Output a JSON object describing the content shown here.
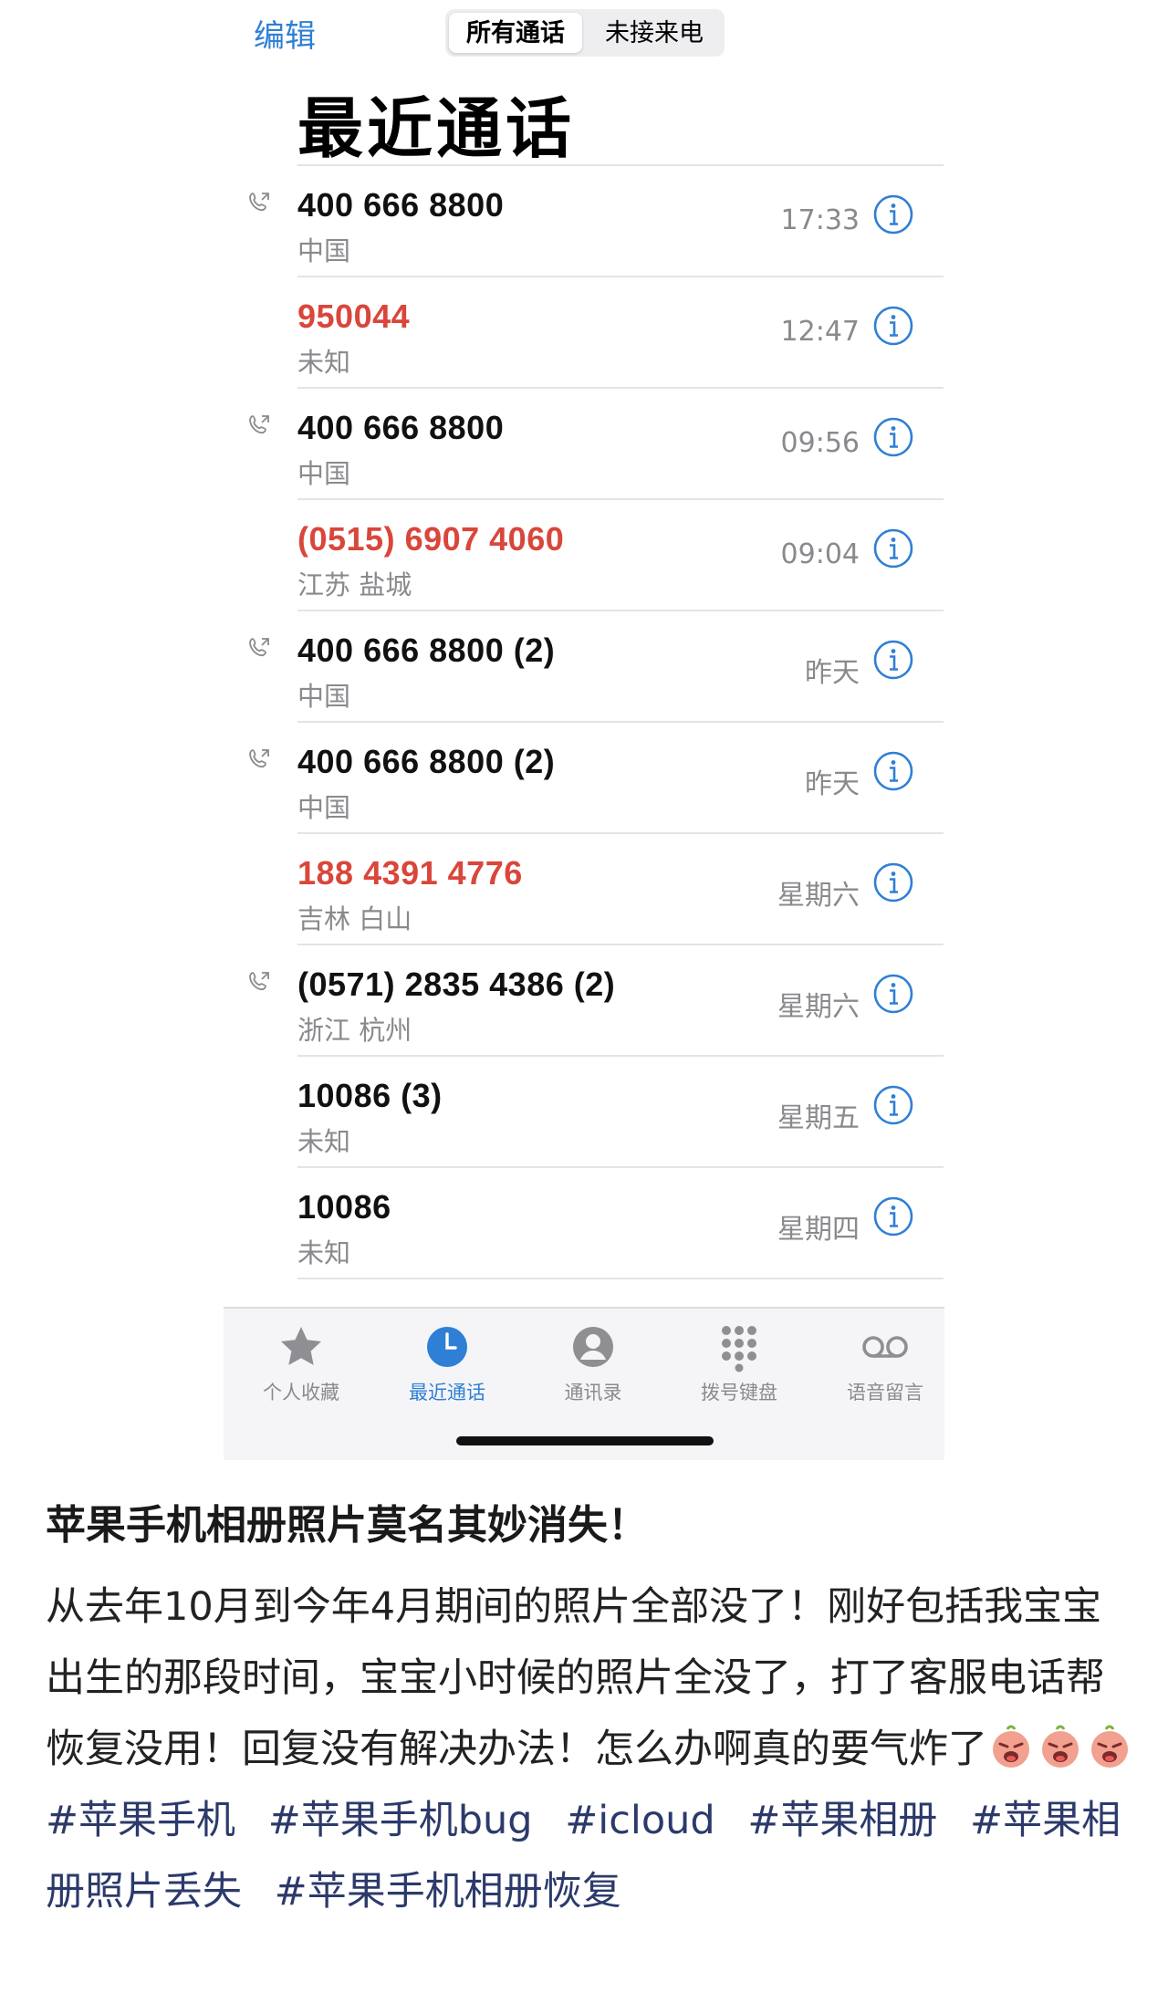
{
  "header": {
    "edit_label": "编辑",
    "segments": [
      "所有通话",
      "未接来电"
    ],
    "title": "最近通话"
  },
  "calls": [
    {
      "number": "400 666 8800",
      "location": "中国",
      "time": "17:33",
      "missed": false,
      "outgoing": true
    },
    {
      "number": "950044",
      "location": "未知",
      "time": "12:47",
      "missed": true,
      "outgoing": false
    },
    {
      "number": "400 666 8800",
      "location": "中国",
      "time": "09:56",
      "missed": false,
      "outgoing": true
    },
    {
      "number": "(0515) 6907 4060",
      "location": "江苏 盐城",
      "time": "09:04",
      "missed": true,
      "outgoing": false
    },
    {
      "number": "400 666 8800 (2)",
      "location": "中国",
      "time": "昨天",
      "missed": false,
      "outgoing": true
    },
    {
      "number": "400 666 8800 (2)",
      "location": "中国",
      "time": "昨天",
      "missed": false,
      "outgoing": true
    },
    {
      "number": "188 4391 4776",
      "location": "吉林 白山",
      "time": "星期六",
      "missed": true,
      "outgoing": false
    },
    {
      "number": "(0571) 2835 4386 (2)",
      "location": "浙江 杭州",
      "time": "星期六",
      "missed": false,
      "outgoing": true
    },
    {
      "number": "10086 (3)",
      "location": "未知",
      "time": "星期五",
      "missed": false,
      "outgoing": false
    },
    {
      "number": "10086",
      "location": "未知",
      "time": "星期四",
      "missed": false,
      "outgoing": false
    }
  ],
  "tabbar": [
    {
      "label": "个人收藏",
      "icon": "star-icon"
    },
    {
      "label": "最近通话",
      "icon": "clock-icon",
      "active": true
    },
    {
      "label": "通讯录",
      "icon": "contact-icon"
    },
    {
      "label": "拨号键盘",
      "icon": "keypad-icon"
    },
    {
      "label": "语音留言",
      "icon": "voicemail-icon"
    }
  ],
  "post": {
    "title": "苹果手机相册照片莫名其妙消失！",
    "body": "从去年10月到今年4月期间的照片全部没了！刚好包括我宝宝出生的那段时间，宝宝小时候的照片全没了，打了客服电话帮恢复没用！回复没有解决办法！怎么办啊真的要气炸了",
    "tags": [
      "#苹果手机",
      "#苹果手机bug",
      "#icloud",
      "#苹果相册",
      "#苹果相册照片丢失",
      "#苹果手机相册恢复"
    ]
  },
  "colors": {
    "accent": "#2f7fd6",
    "missed": "#d9463b",
    "secondary_text": "#8a8a8e"
  }
}
